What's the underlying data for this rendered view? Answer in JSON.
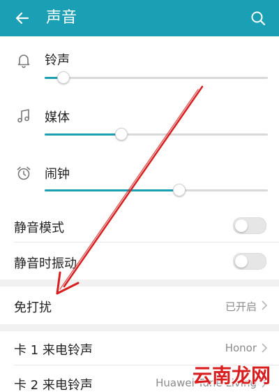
{
  "header": {
    "title": "声音"
  },
  "volume": {
    "ringtone": {
      "label": "铃声",
      "level": 0.08
    },
    "media": {
      "label": "媒体",
      "level": 0.34
    },
    "alarm": {
      "label": "闹钟",
      "level": 0.6
    }
  },
  "settings": {
    "silent_mode": {
      "label": "静音模式",
      "on": false
    },
    "vibrate_silent": {
      "label": "静音时振动",
      "on": false
    },
    "dnd": {
      "label": "免打扰",
      "value": "已开启"
    },
    "sim1_ringtone": {
      "label": "卡 1 来电铃声",
      "value": "Honor"
    },
    "sim2_ringtone": {
      "label": "卡 2 来电铃声",
      "value": "Huawei Tune Living"
    }
  },
  "watermark": "云南龙网",
  "colors": {
    "accent": "#1a9fb5",
    "annotation": "#d81e1e"
  }
}
